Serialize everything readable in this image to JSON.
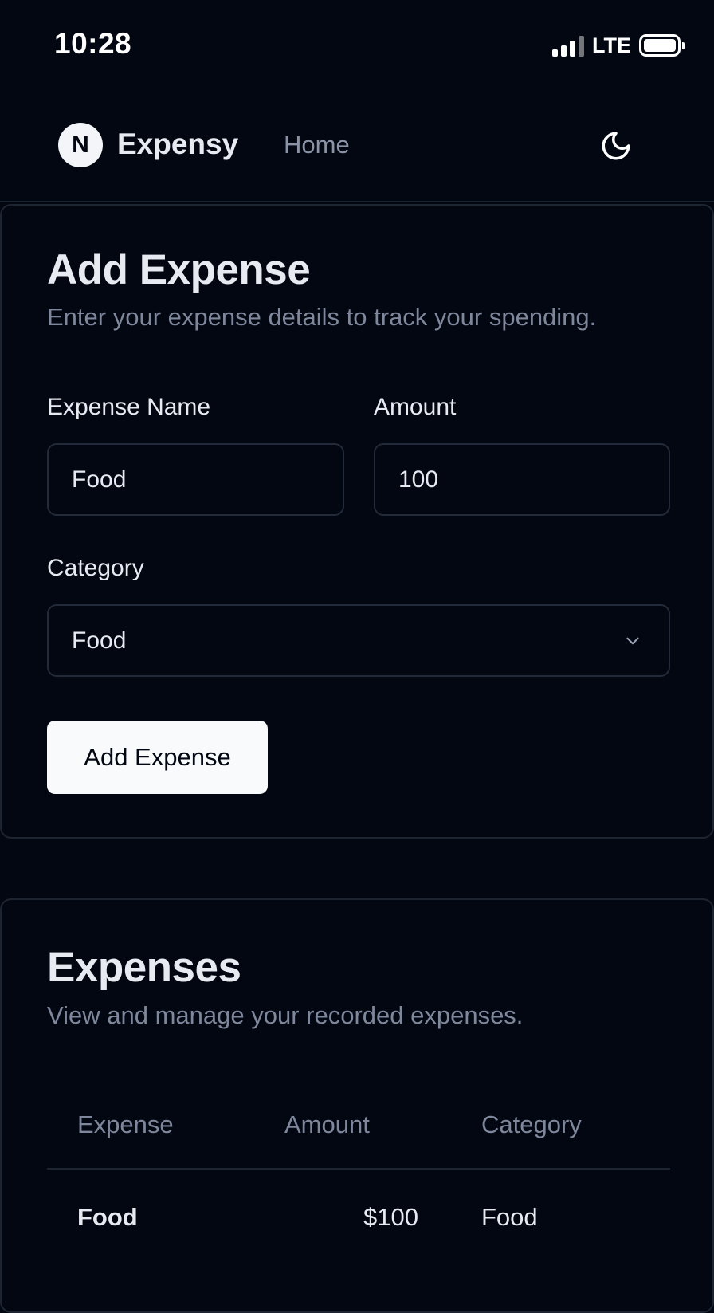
{
  "status_bar": {
    "time": "10:28",
    "network": "LTE"
  },
  "header": {
    "brand": "Expensy",
    "logo_letter": "N",
    "nav_home": "Home",
    "theme_icon": "moon-icon"
  },
  "form": {
    "title": "Add Expense",
    "description": "Enter your expense details to track your spending.",
    "name_label": "Expense Name",
    "name_value": "Food",
    "amount_label": "Amount",
    "amount_value": "100",
    "category_label": "Category",
    "category_value": "Food",
    "submit_label": "Add Expense"
  },
  "expenses": {
    "title": "Expenses",
    "description": "View and manage your recorded expenses.",
    "columns": [
      "Expense",
      "Amount",
      "Category"
    ],
    "rows": [
      {
        "expense": "Food",
        "amount": "$100",
        "category": "Food"
      }
    ]
  },
  "colors": {
    "background": "#030711",
    "border": "#1d2432",
    "muted_text": "#7e879b",
    "button_bg": "#f8fafc"
  }
}
